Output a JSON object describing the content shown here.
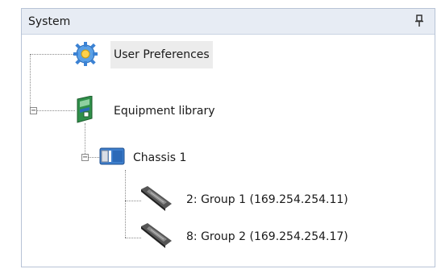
{
  "panel": {
    "title": "System",
    "pin_icon": "pin-icon"
  },
  "tree": {
    "user_preferences": {
      "label": "User Preferences",
      "icon": "gear-icon"
    },
    "equipment_library": {
      "label": "Equipment library",
      "icon": "library-icon",
      "expander": "−"
    },
    "chassis": {
      "label": "Chassis 1",
      "icon": "chassis-icon",
      "expander": "−"
    },
    "groups": [
      {
        "label": "2: Group 1 (169.254.254.11)",
        "icon": "device-icon"
      },
      {
        "label": "8: Group 2 (169.254.254.17)",
        "icon": "device-icon"
      }
    ]
  }
}
